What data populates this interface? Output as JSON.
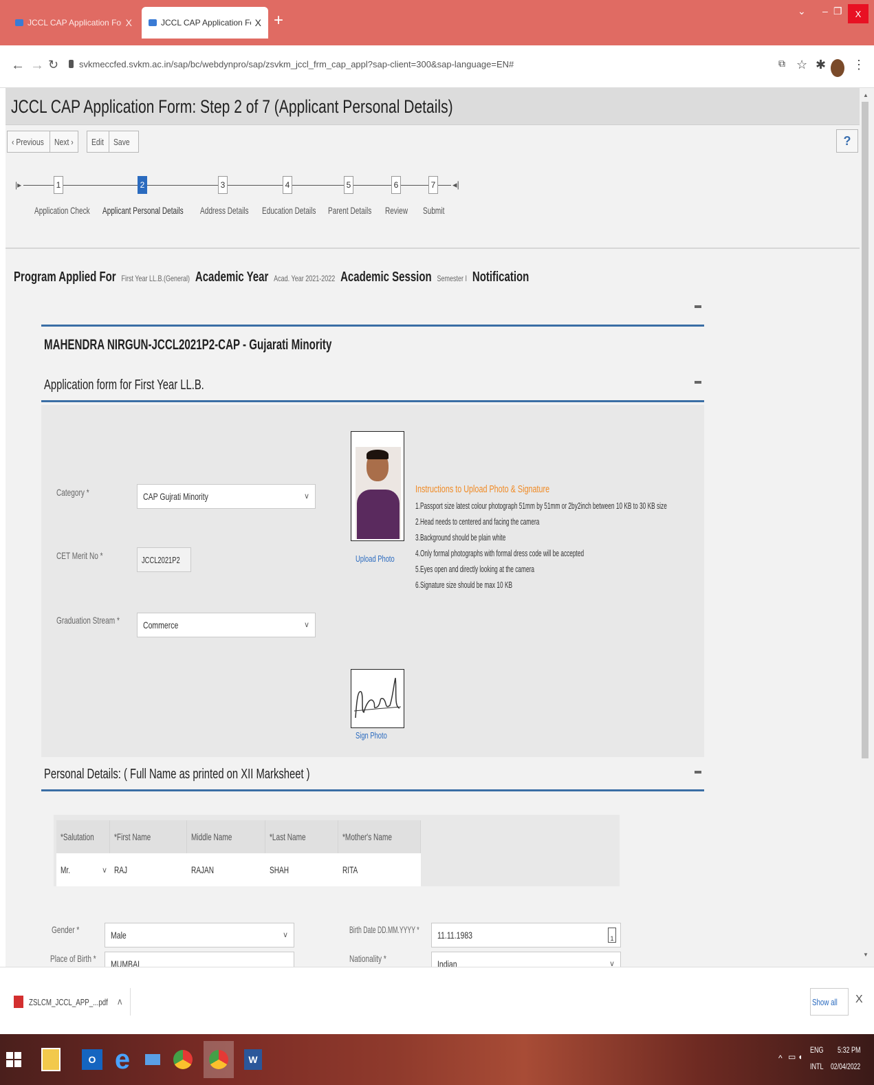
{
  "browser": {
    "tabs": [
      {
        "title": "JCCL CAP Application Form: Ste",
        "close": "X"
      },
      {
        "title": "JCCL CAP Application Form: Ste",
        "close": "X"
      }
    ],
    "new_tab": "+",
    "url": "svkmeccfed.svkm.ac.in/sap/bc/webdynpro/sap/zsvkm_jccl_frm_cap_appl?sap-client=300&sap-language=EN#",
    "window_close": "X"
  },
  "page": {
    "title": "JCCL CAP Application Form: Step 2 of 7 (Applicant Personal Details)",
    "toolbar": {
      "previous": "‹ Previous",
      "next": "Next ›",
      "edit": "Edit",
      "save": "Save"
    },
    "help_label": "?"
  },
  "roadmap": {
    "steps": [
      {
        "num": "1",
        "label": "Application Check"
      },
      {
        "num": "2",
        "label": "Applicant Personal Details"
      },
      {
        "num": "3",
        "label": "Address Details"
      },
      {
        "num": "4",
        "label": "Education Details"
      },
      {
        "num": "5",
        "label": "Parent Details"
      },
      {
        "num": "6",
        "label": "Review"
      },
      {
        "num": "7",
        "label": "Submit"
      }
    ],
    "selected": 2
  },
  "program": {
    "program_label": "Program Applied For",
    "program_value": "First Year LL.B.(General)",
    "year_label": "Academic Year",
    "year_value": "Acad. Year 2021-2022",
    "session_label": "Academic Session",
    "session_value": "Semester I",
    "notification_label": "Notification"
  },
  "applicant": {
    "header": "MAHENDRA NIRGUN-JCCL2021P2-CAP - Gujarati Minority",
    "form_title": "Application form for First Year LL.B.",
    "category_label": "Category *",
    "category_value": "CAP Gujrati Minority",
    "cet_label": "CET Merit No *",
    "cet_value": "JCCL2021P2",
    "stream_label": "Graduation Stream *",
    "stream_value": "Commerce",
    "upload_photo": "Upload Photo",
    "sign_photo": "Sign Photo"
  },
  "instructions": {
    "heading": "Instructions to Upload Photo & Signature",
    "lines": [
      "1.Passport size latest colour photograph 51mm by 51mm or 2by2inch between 10 KB to 30 KB size",
      "2.Head needs to centered and facing the camera",
      "3.Background should be plain white",
      "4.Only formal photographs with formal dress code will be accepted",
      "5.Eyes open and directly looking at the camera",
      "6.Signature size should be max 10 KB"
    ]
  },
  "personal": {
    "title": "Personal Details: ( Full Name as printed on XII Marksheet )",
    "headers": [
      "*Salutation",
      "*First Name",
      "Middle Name",
      "*Last Name",
      "*Mother's Name"
    ],
    "values": [
      "Mr.",
      "RAJ",
      "RAJAN",
      "SHAH",
      "RITA"
    ],
    "gender_label": "Gender *",
    "gender_value": "Male",
    "birthdate_label": "Birth Date DD.MM.YYYY *",
    "birthdate_value": "11.11.1983",
    "birthplace_label": "Place of Birth *",
    "birthplace_value": "MUMBAI",
    "nationality_label": "Nationality *",
    "nationality_value": "Indian"
  },
  "downloads": {
    "file": "ZSLCM_JCCL_APP_...pdf",
    "show_all": "Show all",
    "close": "X"
  },
  "taskbar": {
    "lang1": "ENG",
    "lang2": "INTL",
    "time": "5:32 PM",
    "date": "02/04/2022"
  }
}
